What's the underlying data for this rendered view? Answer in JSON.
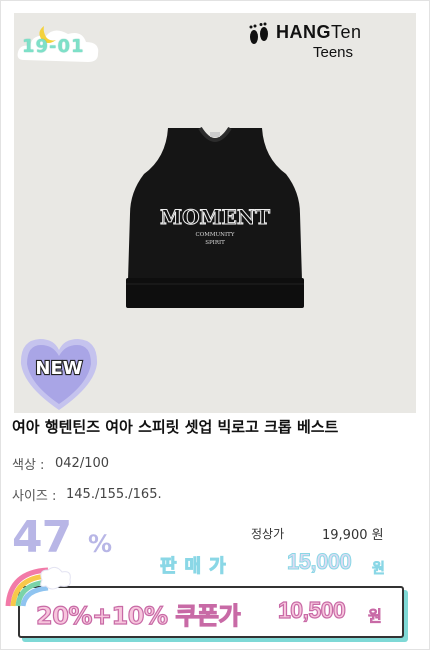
{
  "lot_code": "19-01",
  "brand": {
    "name_bold": "HANG",
    "name_regular": "Ten",
    "sub": "Teens"
  },
  "badge": "NEW",
  "vest_print": {
    "line1": "MOMENT",
    "line2": "COMMUNITY",
    "line3": "SPIRIT"
  },
  "product": {
    "title": "여아 행텐틴즈 여아 스피릿 셋업 빅로고 크롭 베스트",
    "color_label": "색상 :",
    "color_value": "042/100",
    "size_label": "사이즈 :",
    "size_value": "145./155./165."
  },
  "pricing": {
    "discount": "47",
    "discount_sign": "%",
    "regular_label": "정상가",
    "regular_price": "19,900 원",
    "sale_label": "판매가",
    "sale_price": "15,000",
    "sale_unit": "원",
    "coupon_label": "20%+10% 쿠폰가",
    "coupon_price": "10,500",
    "coupon_unit": "원"
  },
  "colors": {
    "photo_bg": "#e9e8e4",
    "accent_lavender": "#b8b6e6",
    "accent_pink": "#f7c6dd",
    "accent_teal": "#7fd9d6"
  }
}
